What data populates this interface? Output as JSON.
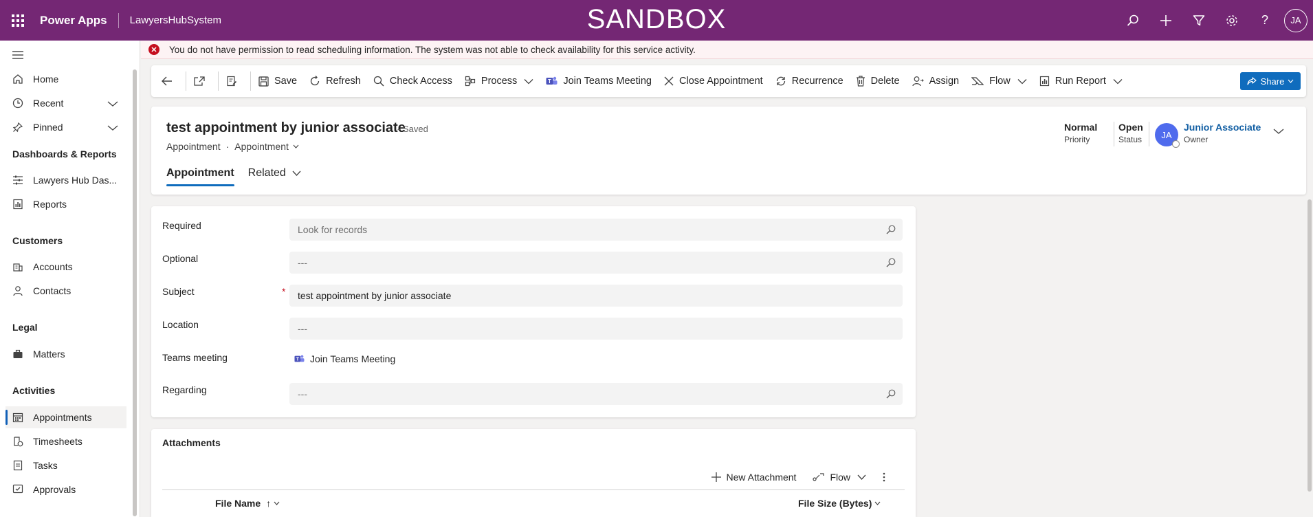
{
  "topbar": {
    "app_name": "Power Apps",
    "system_name": "LawyersHubSystem",
    "environment_banner": "SANDBOX",
    "user_initials": "JA",
    "icons": [
      "search-icon",
      "plus-icon",
      "filter-icon",
      "gear-icon",
      "help-icon"
    ]
  },
  "sidebar": {
    "items_top": [
      {
        "label": "Home",
        "icon": "home-icon"
      },
      {
        "label": "Recent",
        "icon": "clock-icon",
        "expandable": true
      },
      {
        "label": "Pinned",
        "icon": "pin-icon",
        "expandable": true
      }
    ],
    "groups": [
      {
        "title": "Dashboards & Reports",
        "items": [
          {
            "label": "Lawyers Hub Das...",
            "icon": "dashboard-icon"
          },
          {
            "label": "Reports",
            "icon": "report-icon"
          }
        ]
      },
      {
        "title": "Customers",
        "items": [
          {
            "label": "Accounts",
            "icon": "building-icon"
          },
          {
            "label": "Contacts",
            "icon": "person-icon"
          }
        ]
      },
      {
        "title": "Legal",
        "items": [
          {
            "label": "Matters",
            "icon": "briefcase-icon"
          }
        ]
      },
      {
        "title": "Activities",
        "items": [
          {
            "label": "Appointments",
            "icon": "calendar-icon",
            "active": true
          },
          {
            "label": "Timesheets",
            "icon": "timesheet-icon"
          },
          {
            "label": "Tasks",
            "icon": "task-icon"
          },
          {
            "label": "Approvals",
            "icon": "approval-icon"
          }
        ]
      }
    ]
  },
  "error": {
    "message": "You do not have permission to read scheduling information. The system was not able to check availability for this service activity."
  },
  "commandbar": {
    "save": "Save",
    "refresh": "Refresh",
    "check_access": "Check Access",
    "process": "Process",
    "join_teams": "Join Teams Meeting",
    "close_appointment": "Close Appointment",
    "recurrence": "Recurrence",
    "delete": "Delete",
    "assign": "Assign",
    "flow": "Flow",
    "run_report": "Run Report",
    "share": "Share"
  },
  "record": {
    "title": "test appointment by junior associate",
    "saved_status": "- Saved",
    "entity": "Appointment",
    "form_name": "Appointment",
    "priority_value": "Normal",
    "priority_label": "Priority",
    "status_value": "Open",
    "status_label": "Status",
    "owner_initials": "JA",
    "owner_name": "Junior Associate",
    "owner_label": "Owner",
    "tabs": [
      "Appointment",
      "Related"
    ]
  },
  "form": {
    "required_label": "Required",
    "required_placeholder": "Look for records",
    "optional_label": "Optional",
    "optional_value": "---",
    "subject_label": "Subject",
    "subject_required_mark": "*",
    "subject_value": "test appointment by junior associate",
    "location_label": "Location",
    "location_value": "---",
    "teams_label": "Teams meeting",
    "teams_link": "Join Teams Meeting",
    "regarding_label": "Regarding",
    "regarding_value": "---"
  },
  "attachments": {
    "title": "Attachments",
    "new_attachment": "New Attachment",
    "flow": "Flow",
    "col_file_name": "File Name",
    "col_file_size": "File Size (Bytes)"
  }
}
